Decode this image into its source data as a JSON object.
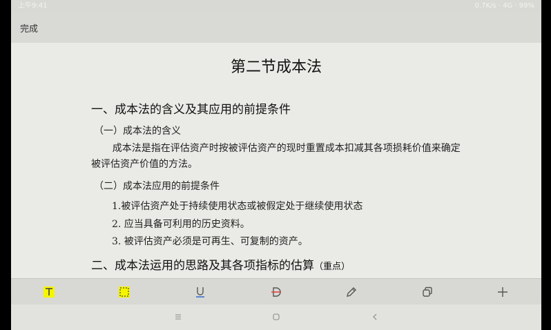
{
  "statusbar": {
    "time": "上午9:41",
    "right": "0.7K/s · 4G · 99%"
  },
  "topbar": {
    "done_label": "完成"
  },
  "document": {
    "title": "第二节成本法",
    "section1": "一、成本法的含义及其应用的前提条件",
    "sub1": "（一）成本法的含义",
    "para1": "成本法是指在评估资产时按被评估资产的现时重置成本扣减其各项损耗价值来确定被评估资产价值的方法。",
    "sub2": "（二）成本法应用的前提条件",
    "item1": "1.被评估资产处于持续使用状态或被假定处于继续使用状态",
    "item2": "2.  应当具备可利用的历史资料。",
    "item3": "3.  被评估资产必须是可再生、可复制的资产。",
    "section2": "二、成本法运用的思路及其各项指标的估算",
    "section2_note": "（重点）"
  },
  "toolbar": {
    "tools": [
      "text-tool",
      "select-area-tool",
      "underline-tool",
      "strikethrough-tool",
      "pen-tool",
      "copy-tool",
      "add-tool"
    ]
  },
  "colors": {
    "highlight": "#f5f500",
    "background": "#eaebe6"
  }
}
